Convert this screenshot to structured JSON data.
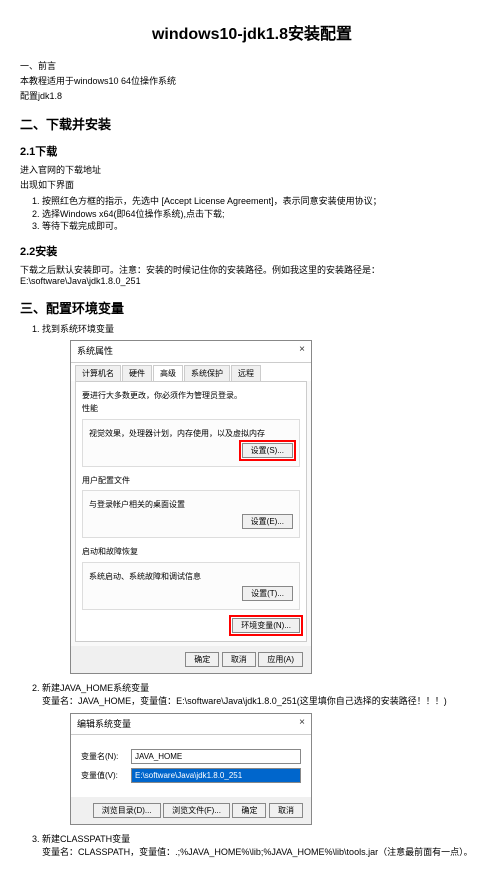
{
  "title": "windows10-jdk1.8安装配置",
  "sec1": {
    "heading": "一、前言",
    "line1": "本教程适用于windows10 64位操作系统",
    "line2": "配置jdk1.8"
  },
  "sec2": {
    "heading": "二、下载并安装",
    "sub1": {
      "heading": "2.1下载",
      "p1": "进入官网的下载地址",
      "p2": "出现如下界面",
      "li1": "按照红色方框的指示，先选中 [Accept License Agreement]，表示同意安装使用协议；",
      "li2": "选择Windows x64(即64位操作系统),点击下载;",
      "li3": "等待下载完成即可。"
    },
    "sub2": {
      "heading": "2.2安装",
      "p1": "下载之后默认安装即可。注意：安装的时候记住你的安装路径。例如我这里的安装路径是：E:\\software\\Java\\jdk1.8.0_251"
    }
  },
  "sec3": {
    "heading": "三、配置环境变量",
    "li1": "找到系统环境变量",
    "li2": "新建JAVA_HOME系统变量",
    "li2_sub": "变量名：JAVA_HOME，变量值：E:\\software\\Java\\jdk1.8.0_251(这里填你自己选择的安装路径！！！)",
    "li3": "新建CLASSPATH变量",
    "li3_sub": "变量名：CLASSPATH，变量值：.;%JAVA_HOME%\\lib;%JAVA_HOME%\\lib\\tools.jar（注意最前面有一点）。"
  },
  "dlg1": {
    "title": "系统属性",
    "close": "×",
    "tabs": {
      "t1": "计算机名",
      "t2": "硬件",
      "t3": "高级",
      "t4": "系统保护",
      "t5": "远程"
    },
    "note": "要进行大多数更改，你必须作为管理员登录。",
    "perf_label": "性能",
    "perf_text": "视觉效果，处理器计划，内存使用，以及虚拟内存",
    "perf_btn": "设置(S)...",
    "user_label": "用户配置文件",
    "user_text": "与登录帐户相关的桌面设置",
    "user_btn": "设置(E)...",
    "start_label": "启动和故障恢复",
    "start_text": "系统启动、系统故障和调试信息",
    "start_btn": "设置(T)...",
    "env_btn": "环境变量(N)...",
    "ok": "确定",
    "cancel": "取消",
    "apply": "应用(A)"
  },
  "dlg2": {
    "title": "编辑系统变量",
    "close": "×",
    "name_label": "变量名(N):",
    "name_value": "JAVA_HOME",
    "val_label": "变量值(V):",
    "val_value": "E:\\software\\Java\\jdk1.8.0_251",
    "browse_dir": "浏览目录(D)...",
    "browse_file": "浏览文件(F)...",
    "ok": "确定",
    "cancel": "取消"
  }
}
